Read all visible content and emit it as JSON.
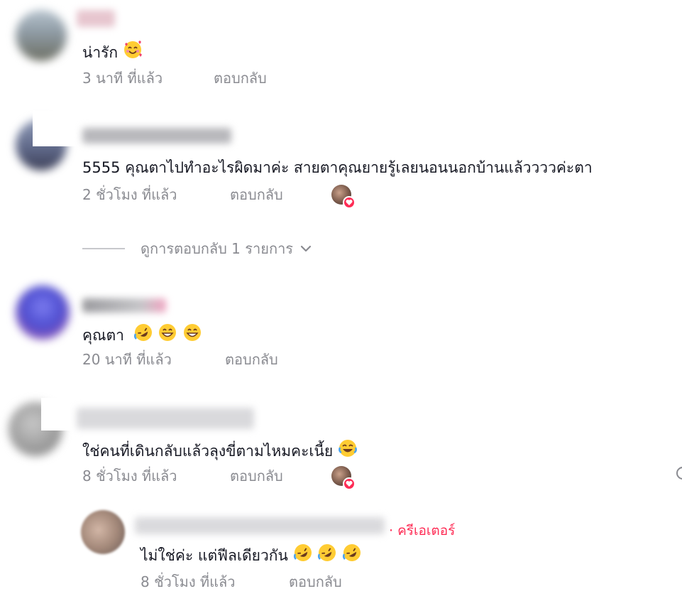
{
  "comments": [
    {
      "text": "น่ารัก",
      "time": "3 นาที ที่แล้ว",
      "reply": "ตอบกลับ",
      "emojis": [
        "smiling-face-with-hearts"
      ]
    },
    {
      "text": "5555 คุณตาไปทำอะไรผิดมาค่ะ สายตาคุณยายรู้เลยนอนนอกบ้านแล้ววววค่ะตา",
      "time": "2 ชั่วโมง ที่แล้ว",
      "reply": "ตอบกลับ",
      "view_replies": "ดูการตอบกลับ 1 รายการ"
    },
    {
      "text": "คุณตา",
      "time": "20 นาที ที่แล้ว",
      "reply": "ตอบกลับ",
      "emojis": [
        "rolling-on-floor-laughing",
        "grinning-face",
        "grinning-face"
      ]
    },
    {
      "text": "ใช่คนที่เดินกลับแล้วลุงขี่ตามไหมคะเนี้ย",
      "time": "8 ชั่วโมง ที่แล้ว",
      "reply": "ตอบกลับ",
      "emojis": [
        "face-with-tears-of-joy"
      ]
    }
  ],
  "creator_reply": {
    "badge": "· ครีเอเตอร์",
    "text": "ไม่ใช่ค่ะ แต่ฟีลเดียวกัน",
    "time": "8 ชั่วโมง ที่แล้ว",
    "reply": "ตอบกลับ",
    "emojis": [
      "rolling-on-floor-laughing",
      "rolling-on-floor-laughing",
      "rolling-on-floor-laughing"
    ]
  },
  "colors": {
    "accent": "#fe2c55",
    "meta_text": "#8a8b91",
    "text": "#161823"
  }
}
